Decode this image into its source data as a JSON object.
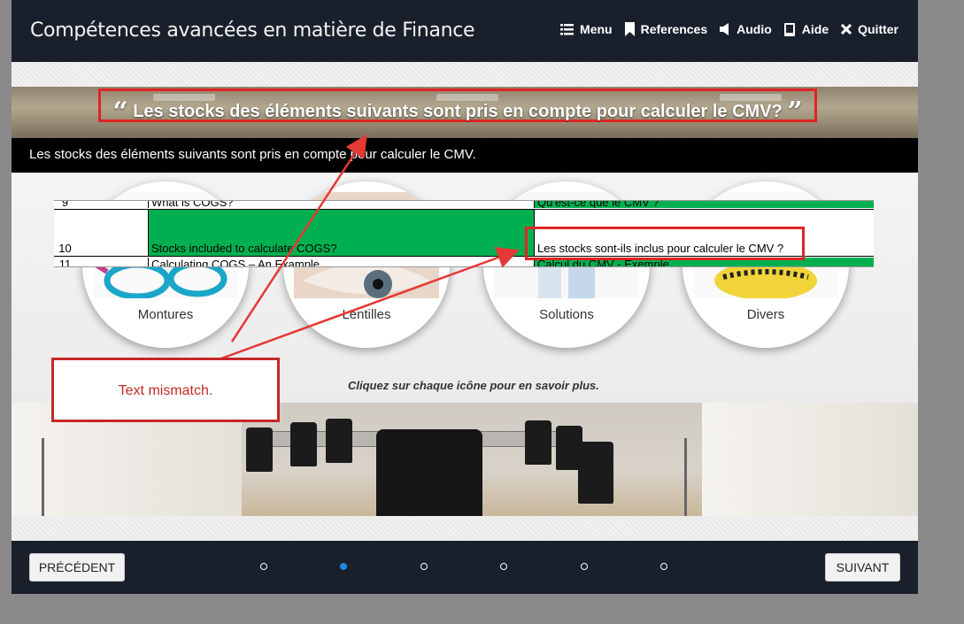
{
  "app": {
    "title": "Compétences avancées en matière de Finance"
  },
  "nav": [
    {
      "icon": "list-icon",
      "label": "Menu"
    },
    {
      "icon": "bookmark-icon",
      "label": "References"
    },
    {
      "icon": "speaker-icon",
      "label": "Audio"
    },
    {
      "icon": "book-icon",
      "label": "Aide"
    },
    {
      "icon": "close-icon",
      "label": "Quitter"
    }
  ],
  "question": {
    "open_quote": "“",
    "text": "Les stocks des éléments suivants sont pris en compte pour calculer le CMV?",
    "close_quote": "”"
  },
  "subtitle": "Les stocks des éléments suivants sont pris en compte pour calculer le CMV.",
  "categories": [
    {
      "label": "Montures"
    },
    {
      "label": "Lentilles"
    },
    {
      "label": "Solutions"
    },
    {
      "label": "Divers"
    }
  ],
  "instruction": "Cliquez sur chaque icône pour en savoir plus.",
  "sheet": {
    "rows": [
      {
        "num": "9",
        "en": "What is COGS?",
        "fr": "Qu'est-ce que le CMV ?"
      },
      {
        "num": "10",
        "en": "Stocks included to calculate COGS?",
        "fr": "Les stocks sont-ils inclus pour calculer le CMV ?"
      },
      {
        "num": "11",
        "en": "Calculating COGS – An Example",
        "fr": "Calcul du CMV - Exemple"
      }
    ]
  },
  "annotation": {
    "text": "Text mismatch."
  },
  "footer": {
    "prev_label": "PRÉCÉDENT",
    "next_label": "SUIVANT",
    "page_count": 6,
    "active_page": 2
  },
  "colors": {
    "header_bg": "#19202c",
    "accent_dot": "#1e88e5",
    "annotation_red": "#e02424",
    "sheet_green": "#00b050"
  }
}
